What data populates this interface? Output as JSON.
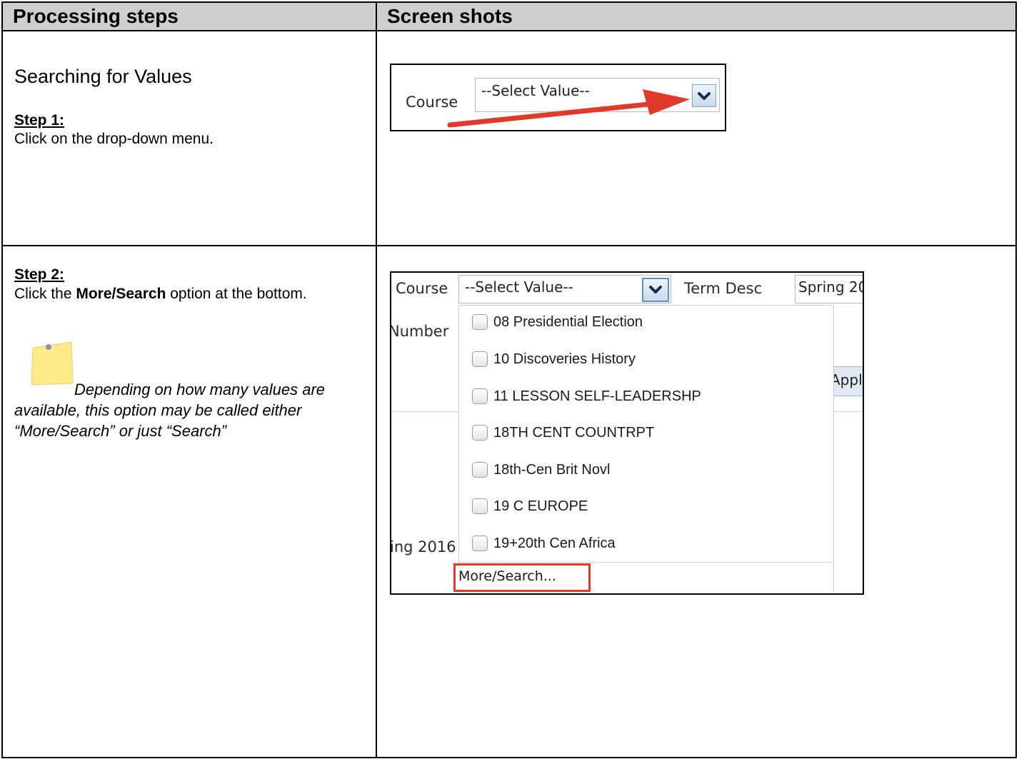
{
  "table": {
    "header_left": "Processing steps",
    "header_right": "Screen shots"
  },
  "row1": {
    "section_title": "Searching for Values",
    "step_label": "Step 1:",
    "step_text": "Click on the drop-down menu.",
    "screenshot": {
      "field_label": "Course",
      "select_value": "--Select Value--"
    }
  },
  "row2": {
    "step_label": "Step 2:",
    "step_text_prefix": "Click the ",
    "step_text_bold": "More/Search",
    "step_text_suffix": " option at the bottom.",
    "note": "Depending on how many values are available, this option may be called either “More/Search” or just “Search”",
    "screenshot": {
      "course_label": "Course",
      "select_value": "--Select Value--",
      "term_label": "Term Desc",
      "term_value": "Spring 20",
      "number_label": "Number",
      "apply_partial": "Appl",
      "spring_partial": "ing 2016",
      "items": [
        "08 Presidential Election",
        "10 Discoveries History",
        "11 LESSON SELF-LEADERSHP",
        "18TH CENT COUNTRPT",
        "18th-Cen Brit Novl",
        "19 C EUROPE",
        "19+20th Cen Africa"
      ],
      "more_search": "More/Search..."
    }
  },
  "colors": {
    "header_bg": "#cfcfcf",
    "arrow": "#e03a2a",
    "highlight_box": "#e03a2a",
    "note_yellow": "#fbe98a"
  }
}
